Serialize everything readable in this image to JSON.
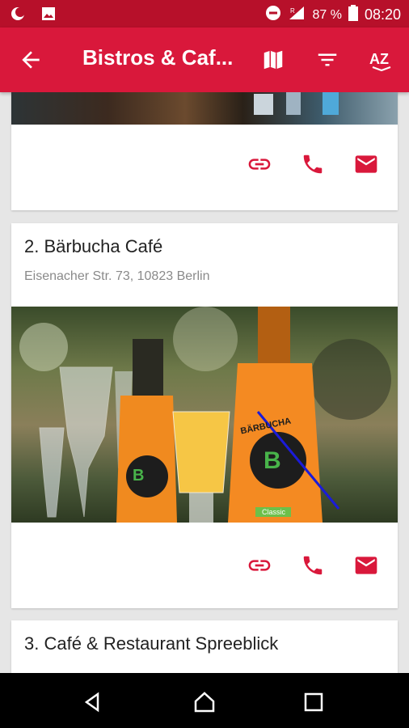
{
  "status_bar": {
    "battery_percent": "87 %",
    "time": "08:20",
    "icons": [
      "moon-icon",
      "image-icon",
      "do-not-disturb-icon",
      "signal-icon",
      "battery-icon"
    ]
  },
  "app_bar": {
    "title": "Bistros & Caf...",
    "icons": [
      "back-arrow-icon",
      "map-icon",
      "filter-icon",
      "sort-az-icon"
    ]
  },
  "cards": [
    {
      "name": "",
      "address": "",
      "actions": [
        "link-icon",
        "phone-icon",
        "mail-icon"
      ]
    },
    {
      "name": "2. Bärbucha Café",
      "address": "Eisenacher Str. 73, 10823 Berlin",
      "image_text": {
        "brand": "BÄRBUCHA",
        "label": "Classic"
      },
      "actions": [
        "link-icon",
        "phone-icon",
        "mail-icon"
      ]
    },
    {
      "name": "3. Café & Restaurant Spreeblick",
      "address": ""
    }
  ],
  "colors": {
    "primary": "#d9183b",
    "status_bar": "#b7102a",
    "accent_icons": "#d9183b",
    "background": "#e6e6e6"
  },
  "nav_bar": {
    "icons": [
      "back-triangle-icon",
      "home-icon",
      "recents-icon"
    ]
  }
}
